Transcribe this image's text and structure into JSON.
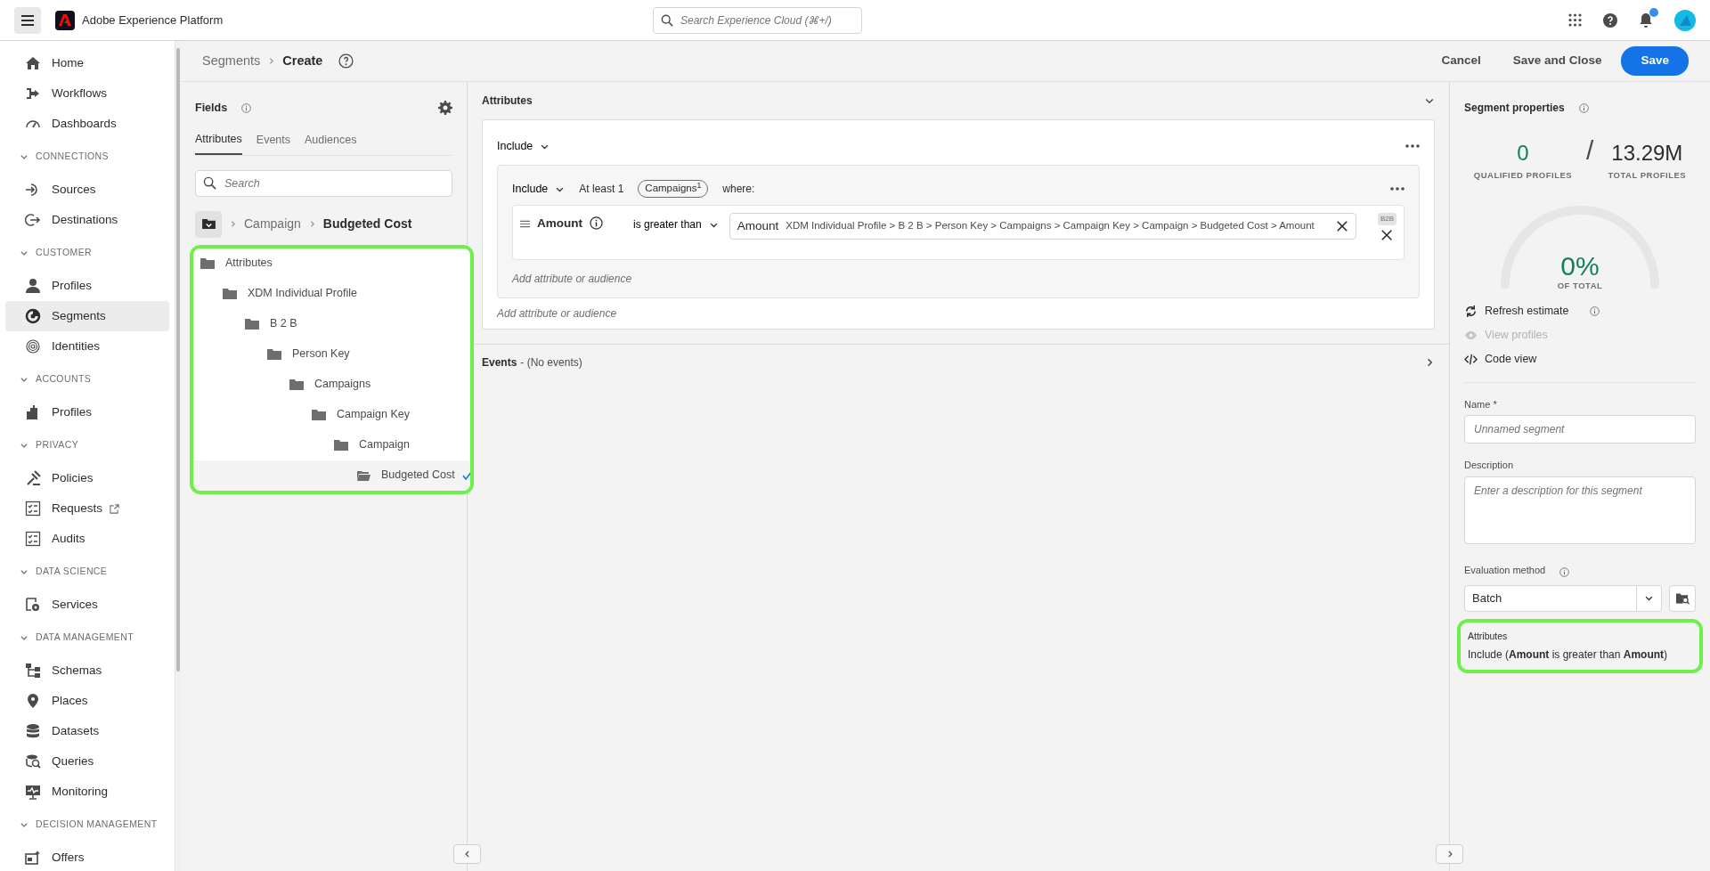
{
  "top_bar": {
    "app_title": "Adobe Experience Platform",
    "search": {
      "placeholder": "Search Experience Cloud (⌘+/)"
    },
    "notifications_unread": true
  },
  "sidebar": {
    "sections": [
      {
        "items": [
          {
            "label": "Home",
            "selected": false
          },
          {
            "label": "Workflows",
            "selected": false
          },
          {
            "label": "Dashboards",
            "selected": false
          }
        ]
      },
      {
        "header": "CONNECTIONS",
        "expanded": true,
        "items": [
          {
            "label": "Sources",
            "selected": false
          },
          {
            "label": "Destinations",
            "selected": false
          }
        ]
      },
      {
        "header": "CUSTOMER",
        "expanded": true,
        "items": [
          {
            "label": "Profiles",
            "selected": false
          },
          {
            "label": "Segments",
            "selected": true
          },
          {
            "label": "Identities",
            "selected": false
          }
        ]
      },
      {
        "header": "ACCOUNTS",
        "expanded": true,
        "items": [
          {
            "label": "Profiles",
            "selected": false
          }
        ]
      },
      {
        "header": "PRIVACY",
        "expanded": true,
        "items": [
          {
            "label": "Policies",
            "selected": false
          },
          {
            "label": "Requests",
            "selected": false,
            "external": true
          },
          {
            "label": "Audits",
            "selected": false
          }
        ]
      },
      {
        "header": "DATA SCIENCE",
        "expanded": true,
        "items": [
          {
            "label": "Services",
            "selected": false
          }
        ]
      },
      {
        "header": "DATA MANAGEMENT",
        "expanded": true,
        "items": [
          {
            "label": "Schemas",
            "selected": false
          },
          {
            "label": "Places",
            "selected": false
          },
          {
            "label": "Datasets",
            "selected": false
          },
          {
            "label": "Queries",
            "selected": false
          },
          {
            "label": "Monitoring",
            "selected": false
          }
        ]
      },
      {
        "header": "DECISION MANAGEMENT",
        "expanded": true,
        "items": [
          {
            "label": "Offers",
            "selected": false
          }
        ]
      }
    ]
  },
  "page_header": {
    "breadcrumb": [
      "Segments",
      "Create"
    ],
    "buttons": [
      {
        "label": "Cancel",
        "kind": "quiet"
      },
      {
        "label": "Save and Close",
        "kind": "quiet"
      },
      {
        "label": "Save",
        "kind": "primary"
      }
    ]
  },
  "fields_panel": {
    "title": "Fields",
    "tabs": [
      {
        "label": "Attributes",
        "selected": true
      },
      {
        "label": "Events",
        "selected": false
      },
      {
        "label": "Audiences",
        "selected": false
      }
    ],
    "search": {
      "placeholder": "Search"
    },
    "path": [
      "Campaign",
      "Budgeted Cost"
    ],
    "highlighted": true,
    "tree": [
      {
        "label": "Attributes",
        "selected": false,
        "children": [
          {
            "label": "XDM Individual Profile",
            "selected": false,
            "children": [
              {
                "label": "B 2 B",
                "selected": false,
                "children": [
                  {
                    "label": "Person Key",
                    "selected": false,
                    "children": [
                      {
                        "label": "Campaigns",
                        "selected": false,
                        "children": [
                          {
                            "label": "Campaign Key",
                            "selected": false,
                            "children": [
                              {
                                "label": "Campaign",
                                "selected": false,
                                "children": [
                                  {
                                    "label": "Budgeted Cost",
                                    "selected": true
                                  }
                                ]
                              }
                            ]
                          }
                        ]
                      }
                    ]
                  }
                ]
              }
            ]
          }
        ]
      }
    ]
  },
  "builder": {
    "attributes": {
      "title": "Attributes",
      "expanded": true,
      "include": "Include",
      "group": {
        "include": "Include",
        "quantifier": "At least 1",
        "chip": "Campaigns$^{1}$",
        "where": "where:",
        "condition": {
          "field": "Amount",
          "operator": "is greater than",
          "value_label": "Amount",
          "value_path": "XDM Individual Profile > B 2 B > Person Key > Campaigns > Campaign Key > Campaign > Budgeted Cost > Amount",
          "badge": "B2B"
        },
        "add_link": "Add attribute or audience"
      },
      "add_link": "Add attribute or audience"
    },
    "events": {
      "title": "Events",
      "note": "- (No events)",
      "expanded": false
    }
  },
  "properties": {
    "title": "Segment properties",
    "qualified": {
      "value": "0",
      "label": "QUALIFIED PROFILES"
    },
    "separator": "/",
    "total": {
      "value": "13.29M",
      "label": "TOTAL PROFILES"
    },
    "gauge": {
      "reading": "0%",
      "caption": "OF TOTAL"
    },
    "actions": [
      {
        "label": "Refresh estimate",
        "disabled": false,
        "info": true
      },
      {
        "label": "View profiles",
        "disabled": true,
        "info": false
      },
      {
        "label": "Code view",
        "disabled": false,
        "info": false
      }
    ],
    "name": {
      "label": "Name *",
      "placeholder": "Unnamed segment"
    },
    "description": {
      "label": "Description",
      "placeholder": "Enter a description for this segment"
    },
    "evaluation": {
      "label": "Evaluation method",
      "value": "Batch"
    },
    "summary": {
      "heading": "Attributes",
      "text": "Include (**Amount** is greater than **Amount**)",
      "highlighted": true
    }
  }
}
